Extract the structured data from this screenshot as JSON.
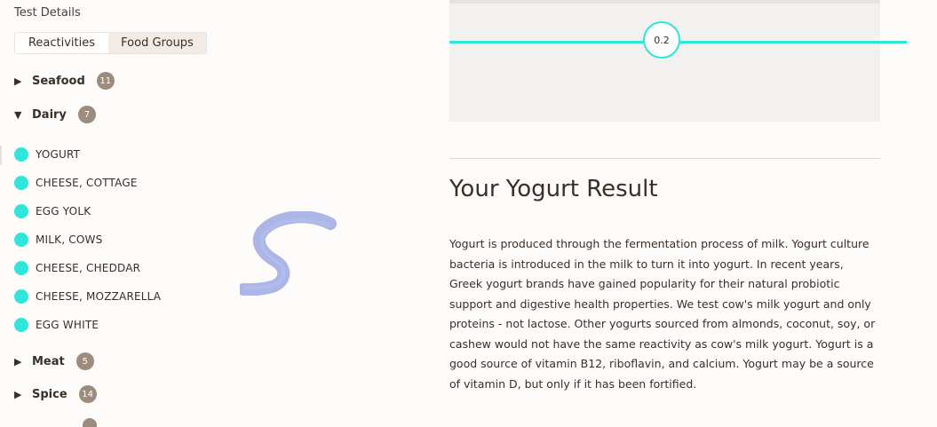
{
  "sidebar": {
    "title": "Test Details",
    "tabs": [
      {
        "label": "Reactivities"
      },
      {
        "label": "Food Groups"
      }
    ],
    "groups": {
      "seafood": {
        "label": "Seafood",
        "count": "11"
      },
      "dairy": {
        "label": "Dairy",
        "count": "7"
      },
      "meat": {
        "label": "Meat",
        "count": "5"
      },
      "spice": {
        "label": "Spice",
        "count": "14"
      }
    },
    "dairy_items": [
      "YOGURT",
      "CHEESE, COTTAGE",
      "EGG YOLK",
      "MILK, COWS",
      "CHEESE, CHEDDAR",
      "CHEESE, MOZZARELLA",
      "EGG WHITE"
    ]
  },
  "chart": {
    "marker_value": "0.2"
  },
  "result": {
    "title": "Your Yogurt Result",
    "body": "Yogurt is produced through the fermentation process of milk. Yogurt culture bacteria is introduced in the milk to turn it into yogurt. In recent years, Greek yogurt brands have gained popularity for their natural probiotic support and digestive health properties. We test cow's milk yogurt and only proteins - not lactose. Other yogurts sourced from almonds, coconut, soy, or cashew would not have the same reactivity as cow's milk yogurt. Yogurt is a good source of vitamin B12, riboflavin, and calcium. Yogurt may be a source of vitamin D, but only if it has been fortified."
  },
  "colors": {
    "accent": "#2ee5d8",
    "badge": "#9b8c7e",
    "text": "#3a2e26",
    "squiggle": "#8f9fe0"
  }
}
